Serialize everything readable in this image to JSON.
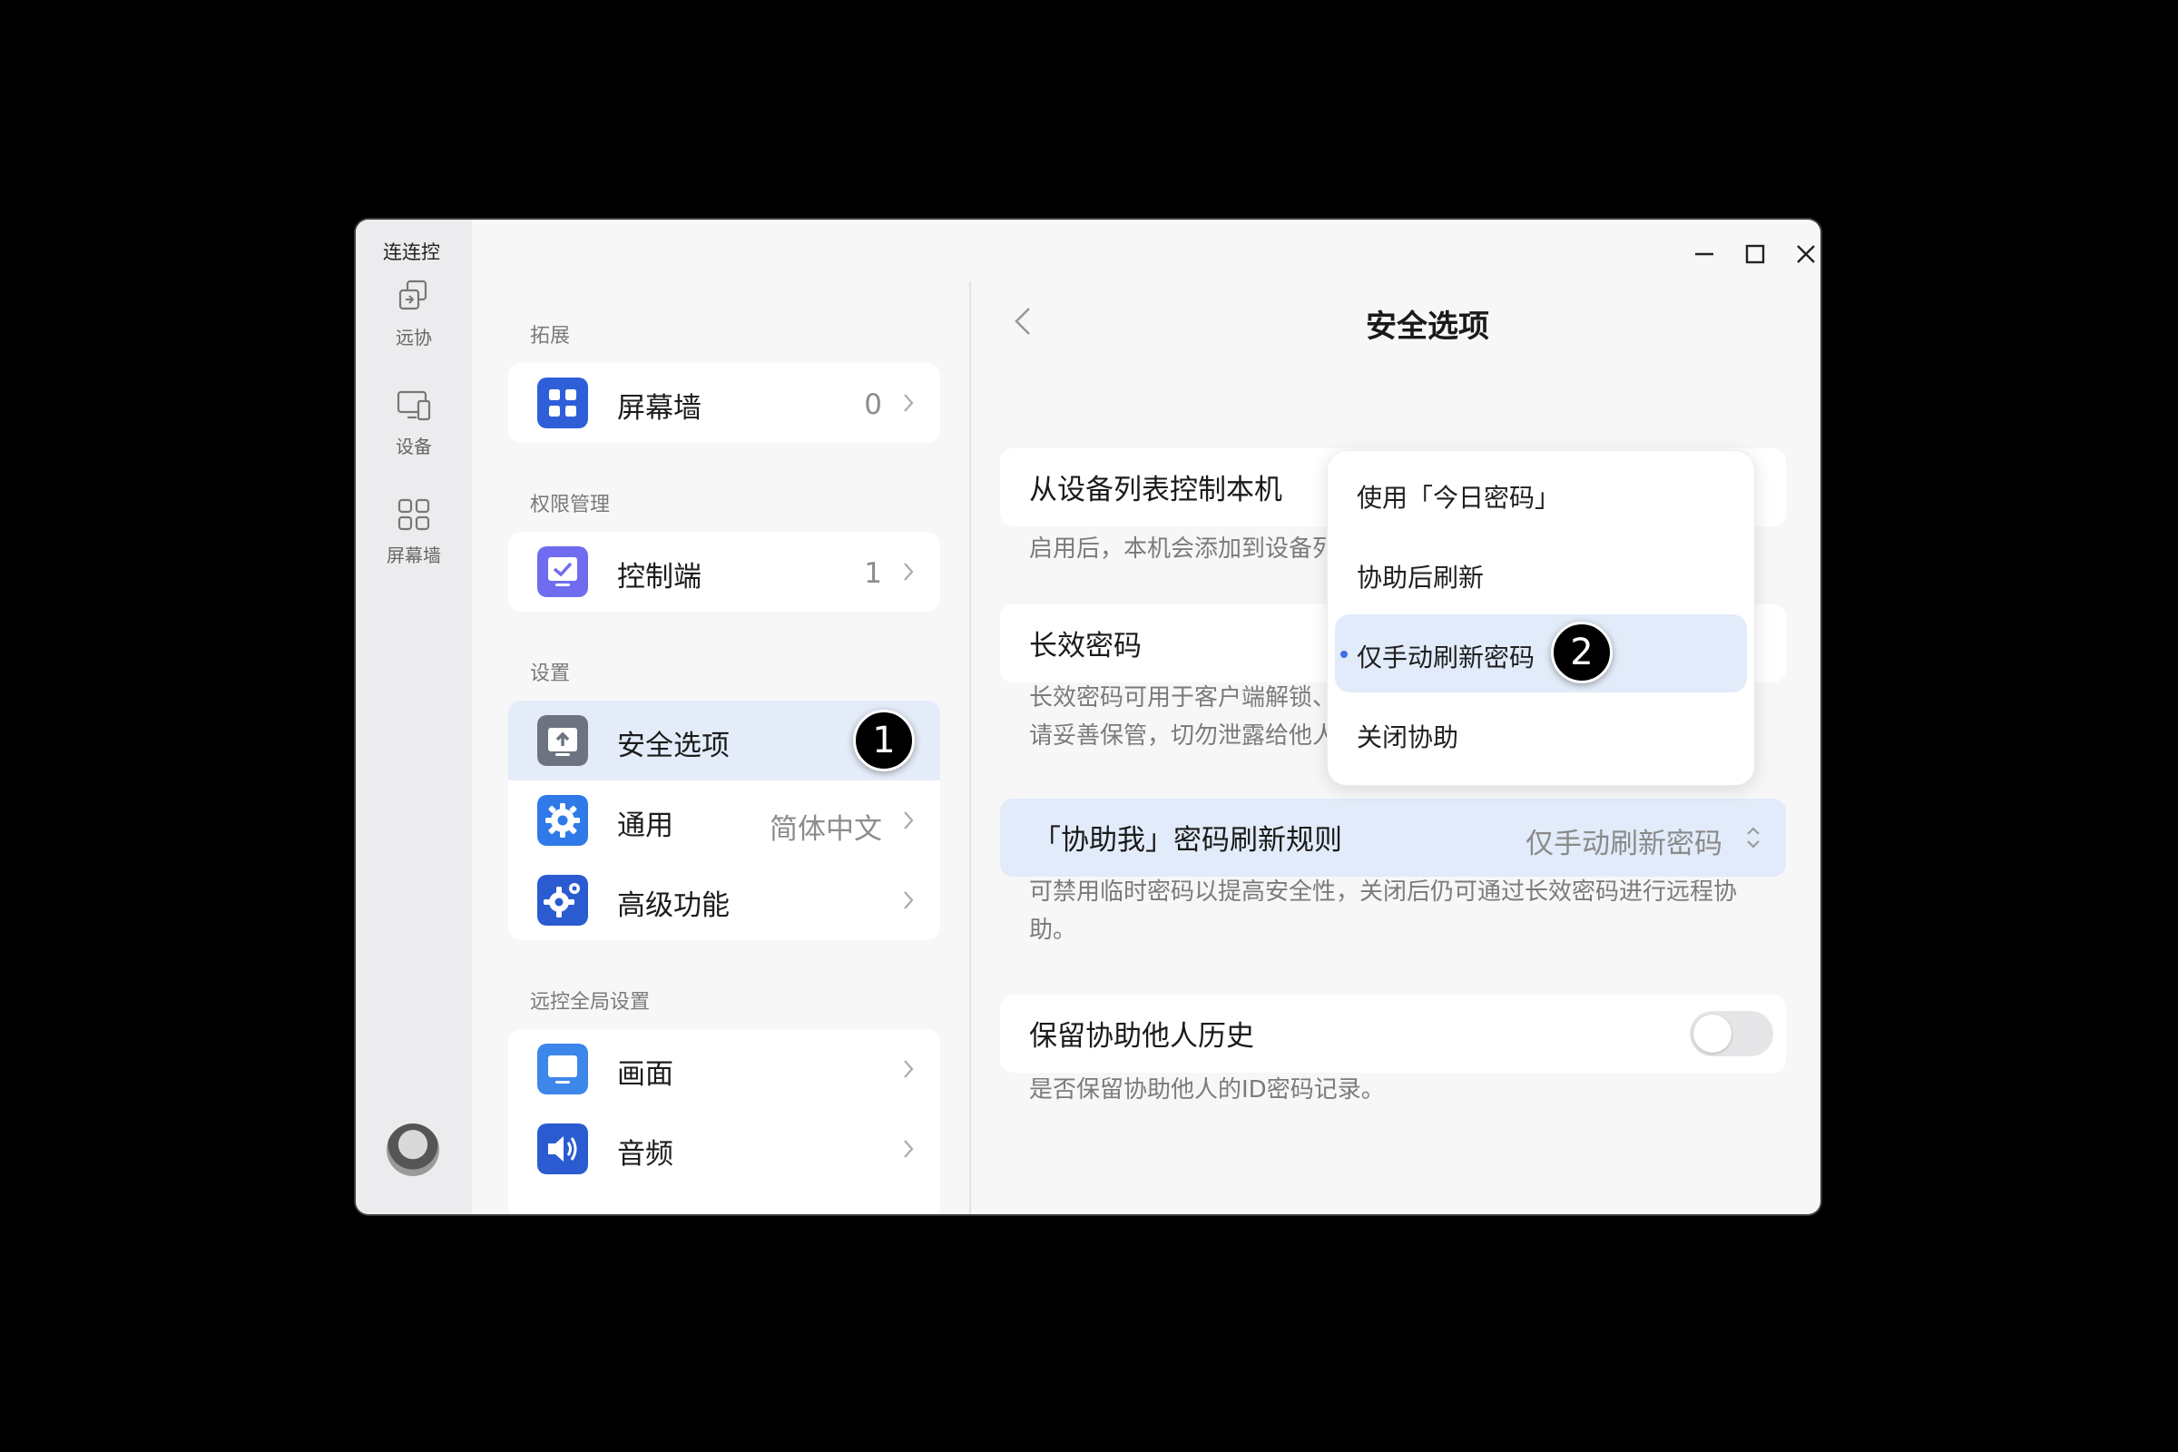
{
  "app": {
    "title": "连连控"
  },
  "rail": {
    "items": [
      {
        "label": "远协"
      },
      {
        "label": "设备"
      },
      {
        "label": "屏幕墙"
      }
    ]
  },
  "middle": {
    "sections": [
      {
        "label": "拓展"
      },
      {
        "label": "权限管理"
      },
      {
        "label": "设置"
      },
      {
        "label": "远控全局设置"
      }
    ],
    "items": {
      "screen_wall": {
        "label": "屏幕墙",
        "value": "0"
      },
      "controller": {
        "label": "控制端",
        "value": "1"
      },
      "security": {
        "label": "安全选项"
      },
      "general": {
        "label": "通用",
        "value": "简体中文"
      },
      "advanced": {
        "label": "高级功能"
      },
      "display": {
        "label": "画面"
      },
      "audio": {
        "label": "音频"
      }
    }
  },
  "badges": {
    "one": "1",
    "two": "2"
  },
  "right": {
    "title": "安全选项",
    "device_control": {
      "title": "从设备列表控制本机",
      "desc": "启用后，本机会添加到设备列"
    },
    "long_password": {
      "title": "长效密码",
      "desc_line1": "长效密码可用于客户端解锁、",
      "desc_line2": "请妥善保管，切勿泄露给他人"
    },
    "refresh_rule": {
      "title": "「协助我」密码刷新规则",
      "value": "仅手动刷新密码",
      "desc": "可禁用临时密码以提高安全性，关闭后仍可通过长效密码进行远程协助。"
    },
    "keep_history": {
      "title": "保留协助他人历史",
      "desc": "是否保留协助他人的ID密码记录。",
      "enabled": false
    }
  },
  "dropdown": {
    "options": [
      {
        "label": "使用「今日密码」"
      },
      {
        "label": "协助后刷新"
      },
      {
        "label": "仅手动刷新密码",
        "selected": true
      },
      {
        "label": "关闭协助"
      }
    ]
  },
  "colors": {
    "accent": "#3d6fe6",
    "selected_bg": "#e2ebf9",
    "icon_blue": "#2f6fe0",
    "icon_purple": "#6f6cf0",
    "icon_gray": "#6d7380"
  }
}
